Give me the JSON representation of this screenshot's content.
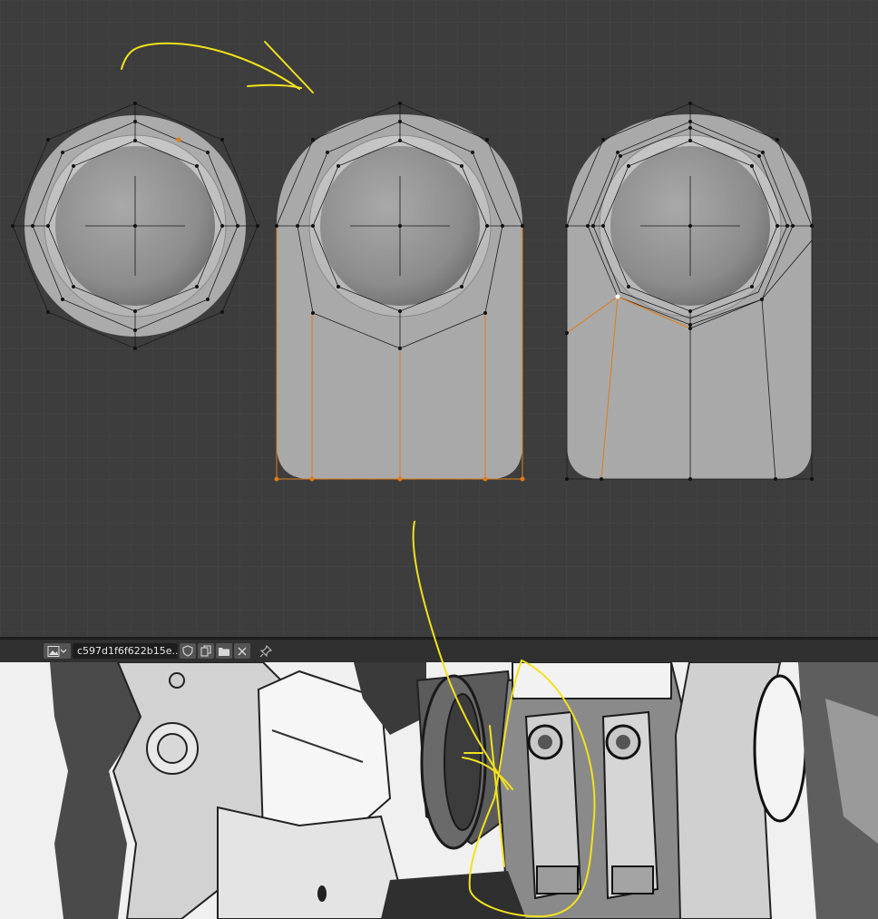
{
  "viewport": {
    "background": "#3d3d3d",
    "grid_color": "#484848",
    "mesh_fill": "#a8a8a8",
    "selection_color": "#e07b1a",
    "annotation_color": "#f2e21c"
  },
  "image_editor": {
    "header": {
      "image_type_icon": "image-icon",
      "image_name": "c597d1f6f622b15e...",
      "fake_user_icon": "shield-icon",
      "duplicate_icon": "duplicate-icon",
      "open_icon": "folder-icon",
      "unlink_icon": "close-icon",
      "pin_icon": "pin-icon"
    }
  }
}
